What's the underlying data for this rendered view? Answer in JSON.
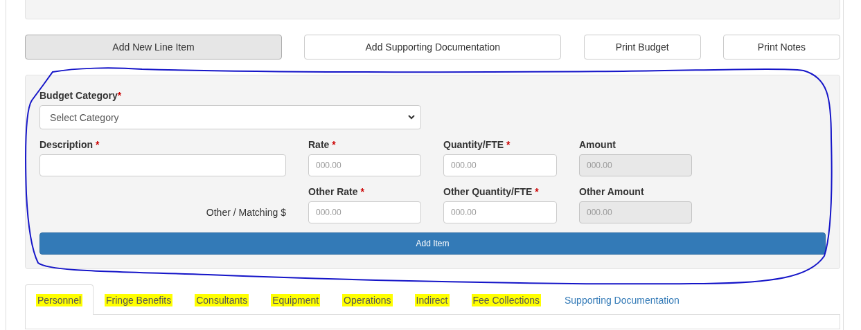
{
  "actions": [
    {
      "label": "Add New Line Item",
      "active": true
    },
    {
      "label": "Add Supporting Documentation",
      "active": false
    },
    {
      "label": "Print Budget",
      "active": false
    },
    {
      "label": "Print Notes",
      "active": false
    }
  ],
  "form": {
    "category": {
      "label": "Budget Category",
      "required": true,
      "value": "Select Category"
    },
    "description": {
      "label": "Description",
      "required": true
    },
    "row_1": [
      {
        "label": "Rate",
        "required": true,
        "placeholder": "000.00",
        "kind": "input"
      },
      {
        "label": "Quantity/FTE",
        "required": true,
        "placeholder": "000.00",
        "kind": "input"
      },
      {
        "label": "Amount",
        "required": false,
        "placeholder": "000.00",
        "kind": "computed"
      }
    ],
    "other_label": "Other / Matching $",
    "row_2": [
      {
        "label": "Other Rate",
        "required": true,
        "placeholder": "000.00",
        "kind": "input"
      },
      {
        "label": "Other Quantity/FTE",
        "required": true,
        "placeholder": "000.00",
        "kind": "input"
      },
      {
        "label": "Other Amount",
        "required": false,
        "placeholder": "000.00",
        "kind": "computed"
      }
    ],
    "submit": "Add Item",
    "required_mark": "*"
  },
  "tabs": [
    {
      "label": "Personnel",
      "selected": true,
      "highlighted": true
    },
    {
      "label": "Fringe Benefits",
      "selected": false,
      "highlighted": true
    },
    {
      "label": "Consultants",
      "selected": false,
      "highlighted": true
    },
    {
      "label": "Equipment",
      "selected": false,
      "highlighted": true
    },
    {
      "label": "Operations",
      "selected": false,
      "highlighted": true
    },
    {
      "label": "Indirect",
      "selected": false,
      "highlighted": true
    },
    {
      "label": "Fee Collections",
      "selected": false,
      "highlighted": true
    },
    {
      "label": "Supporting Documentation",
      "selected": false,
      "highlighted": false
    }
  ]
}
